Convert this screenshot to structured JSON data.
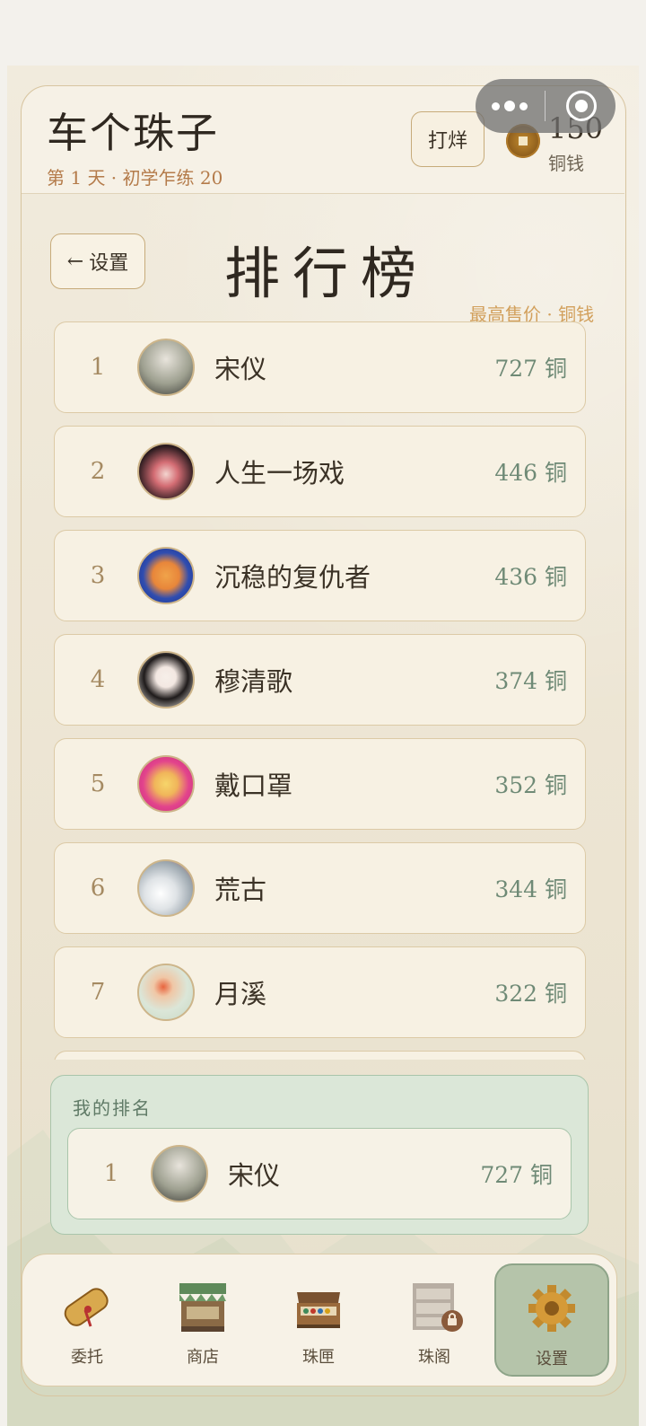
{
  "header": {
    "title": "车个珠子",
    "day_info": "第 1 天 · 初学乍练 20",
    "polish_label": "打烊",
    "coins": "150",
    "coins_label": "铜钱"
  },
  "leaderboard": {
    "back_label": "设置",
    "title": "排行榜",
    "subtitle": "最高售价 · 铜钱",
    "rows": [
      {
        "rank": "1",
        "name": "宋仪",
        "price": "727 铜"
      },
      {
        "rank": "2",
        "name": "人生一场戏",
        "price": "446 铜"
      },
      {
        "rank": "3",
        "name": "沉稳的复仇者",
        "price": "436 铜"
      },
      {
        "rank": "4",
        "name": "穆清歌",
        "price": "374 铜"
      },
      {
        "rank": "5",
        "name": "戴口罩",
        "price": "352 铜"
      },
      {
        "rank": "6",
        "name": "荒古",
        "price": "344 铜"
      },
      {
        "rank": "7",
        "name": "月溪",
        "price": "322 铜"
      }
    ]
  },
  "my_rank": {
    "label": "我的排名",
    "rank": "1",
    "name": "宋仪",
    "price": "727 铜"
  },
  "nav": {
    "items": [
      {
        "label": "委托",
        "icon": "scroll-icon"
      },
      {
        "label": "商店",
        "icon": "shop-icon"
      },
      {
        "label": "珠匣",
        "icon": "chest-icon"
      },
      {
        "label": "珠阁",
        "icon": "cabinet-icon"
      },
      {
        "label": "设置",
        "icon": "gear-icon"
      }
    ],
    "active": "设置"
  },
  "colors": {
    "accent": "#b47b4a",
    "price": "#6f8a76",
    "my_rank_bg": "#dbe7d8",
    "nav_active": "#b5c4aa"
  }
}
